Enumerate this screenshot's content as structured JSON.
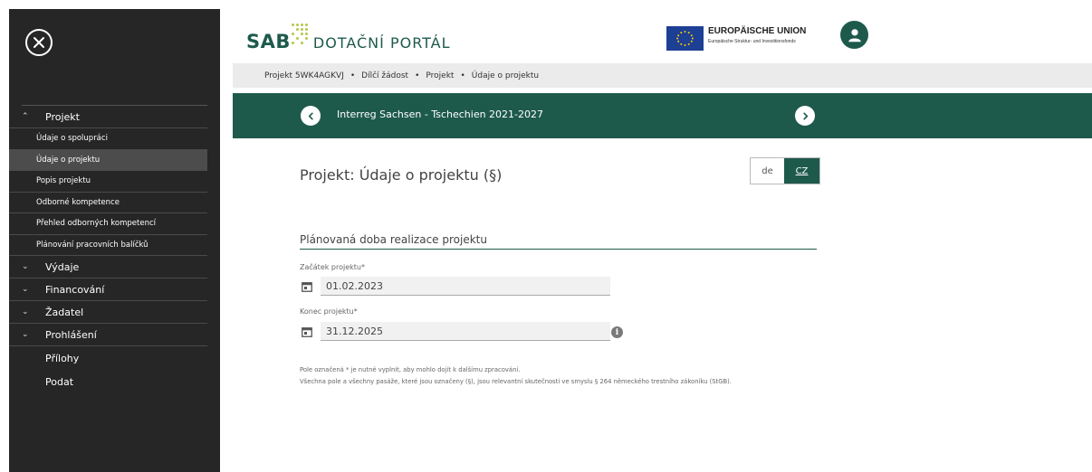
{
  "header": {
    "logo_main": "SAB",
    "logo_portal": "DOTAČNÍ PORTÁL",
    "eu_title": "EUROPÄISCHE UNION",
    "eu_subtitle": "Europäische Struktur- und Investitionsfonds"
  },
  "breadcrumb": [
    "Projekt 5WK4AGKVJ",
    "Dílčí žádost",
    "Projekt",
    "Údaje o projektu"
  ],
  "program": {
    "title": "Interreg Sachsen - Tschechien 2021-2027"
  },
  "sidebar": {
    "sections": [
      {
        "label": "Projekt",
        "expanded": true,
        "items": [
          "Údaje o spolupráci",
          "Údaje o projektu",
          "Popis projektu",
          "Odborné kompetence",
          "Přehled odborných kompetencí",
          "Plánování pracovních balíčků"
        ],
        "active_item": "Údaje o projektu"
      },
      {
        "label": "Výdaje",
        "expanded": false
      },
      {
        "label": "Financování",
        "expanded": false
      },
      {
        "label": "Žadatel",
        "expanded": false
      },
      {
        "label": "Prohlášení",
        "expanded": false
      }
    ],
    "plain_items": [
      "Přílohy",
      "Podat"
    ]
  },
  "main": {
    "page_title": "Projekt: Údaje o projektu (§)",
    "lang": {
      "de": "de",
      "cz": "CZ",
      "active": "CZ"
    },
    "section_title": "Plánovaná doba realizace projektu",
    "start_label": "Začátek projektu*",
    "start_value": "01.02.2023",
    "end_label": "Konec projektu*",
    "end_value": "31.12.2025",
    "footnote_1": "Pole označená * je nutné vyplnit, aby mohlo dojít k dalšímu zpracování.",
    "footnote_2": "Všechna pole a všechny pasáže, které jsou označeny (§), jsou relevantní skutečnosti ve smyslu § 264 německého trestního zákoníku (StGB)."
  },
  "colors": {
    "brand": "#1e5a4c",
    "sidebar": "#262626",
    "accent_dots": "#b6c64a",
    "eu_blue": "#1d3f94"
  },
  "icons": [
    "close-icon",
    "chevron-up-icon",
    "chevron-down-icon",
    "user-icon",
    "chevron-left-icon",
    "chevron-right-icon",
    "calendar-icon",
    "info-icon"
  ]
}
